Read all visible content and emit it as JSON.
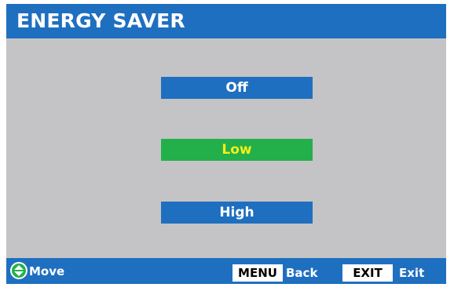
{
  "title": "ENERGY SAVER",
  "options": [
    {
      "label": "Off",
      "selected": false
    },
    {
      "label": "Low",
      "selected": true
    },
    {
      "label": "High",
      "selected": false
    }
  ],
  "footer": {
    "move_label": "Move",
    "menu_key": "MENU",
    "menu_label": "Back",
    "exit_key": "EXIT",
    "exit_label": "Exit"
  },
  "colors": {
    "bar_blue": "#1f6fc0",
    "selected_green": "#23b04a",
    "selected_text": "#f4ef1a",
    "background": "#c4c4c6"
  }
}
